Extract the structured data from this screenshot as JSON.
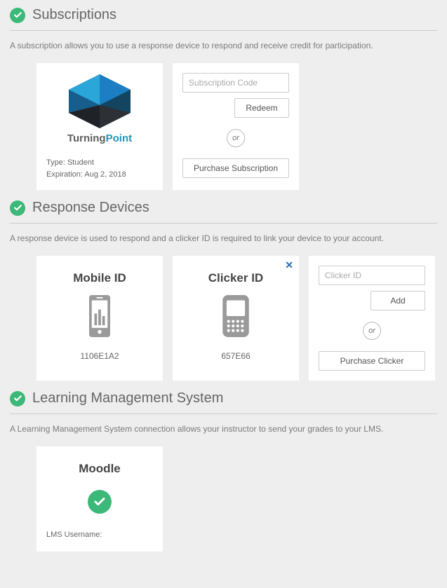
{
  "subscriptions": {
    "title": "Subscriptions",
    "desc": "A subscription allows you to use a response device to respond and receive credit for participation.",
    "tpName": "TurningPoint",
    "tpTurning": "Turning",
    "tpPoint": "Point",
    "typeLabel": "Type: Student",
    "expiration": "Expiration: Aug 2, 2018",
    "codePlaceholder": "Subscription Code",
    "redeem": "Redeem",
    "or": "or",
    "purchase": "Purchase Subscription"
  },
  "devices": {
    "title": "Response Devices",
    "desc": "A response device is used to respond and a clicker ID is required to link your device to your account.",
    "mobile": {
      "title": "Mobile ID",
      "id": "1106E1A2"
    },
    "clicker": {
      "title": "Clicker ID",
      "id": "657E66"
    },
    "close": "✕",
    "idPlaceholder": "Clicker ID",
    "add": "Add",
    "or": "or",
    "purchase": "Purchase Clicker"
  },
  "lms": {
    "title": "Learning Management System",
    "desc": "A Learning Management System connection allows your instructor to send your grades to your LMS.",
    "name": "Moodle",
    "usernameLabel": "LMS Username:"
  }
}
